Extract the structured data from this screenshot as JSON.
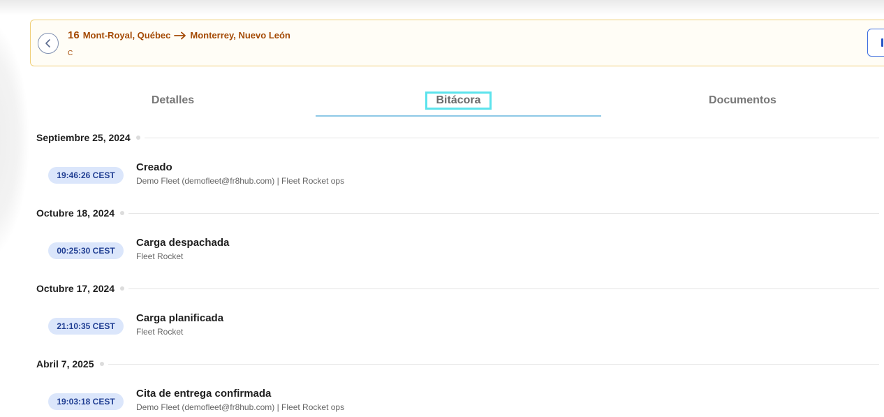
{
  "header": {
    "route_number": "16",
    "origin": "Mont-Royal, Québec",
    "destination": "Monterrey, Nuevo León",
    "sub": "C"
  },
  "tabs": [
    {
      "label": "Detalles",
      "active": false
    },
    {
      "label": "Bitácora",
      "active": true
    },
    {
      "label": "Documentos",
      "active": false
    }
  ],
  "timeline": [
    {
      "date": "Septiembre 25, 2024",
      "events": [
        {
          "time": "19:46:26 CEST",
          "title": "Creado",
          "detail": "Demo Fleet (demofleet@fr8hub.com) | Fleet Rocket ops"
        }
      ]
    },
    {
      "date": "Octubre 18, 2024",
      "events": [
        {
          "time": "00:25:30 CEST",
          "title": "Carga despachada",
          "detail": "Fleet Rocket"
        }
      ]
    },
    {
      "date": "Octubre 17, 2024",
      "events": [
        {
          "time": "21:10:35 CEST",
          "title": "Carga planificada",
          "detail": "Fleet Rocket"
        }
      ]
    },
    {
      "date": "Abril 7, 2025",
      "events": [
        {
          "time": "19:03:18 CEST",
          "title": "Cita de entrega confirmada",
          "detail": "Demo Fleet (demofleet@fr8hub.com) | Fleet Rocket ops"
        }
      ]
    }
  ],
  "colors": {
    "accent_orange": "#a44a05",
    "header_border": "#f0cf78",
    "badge_bg": "#dbe6fb",
    "badge_text": "#213f93",
    "tab_underline": "#8ec9e6",
    "tab_focus": "#5ce3ec"
  },
  "icons": {
    "back": "chevron-left-icon",
    "route_arrow": "arrow-right-icon"
  }
}
